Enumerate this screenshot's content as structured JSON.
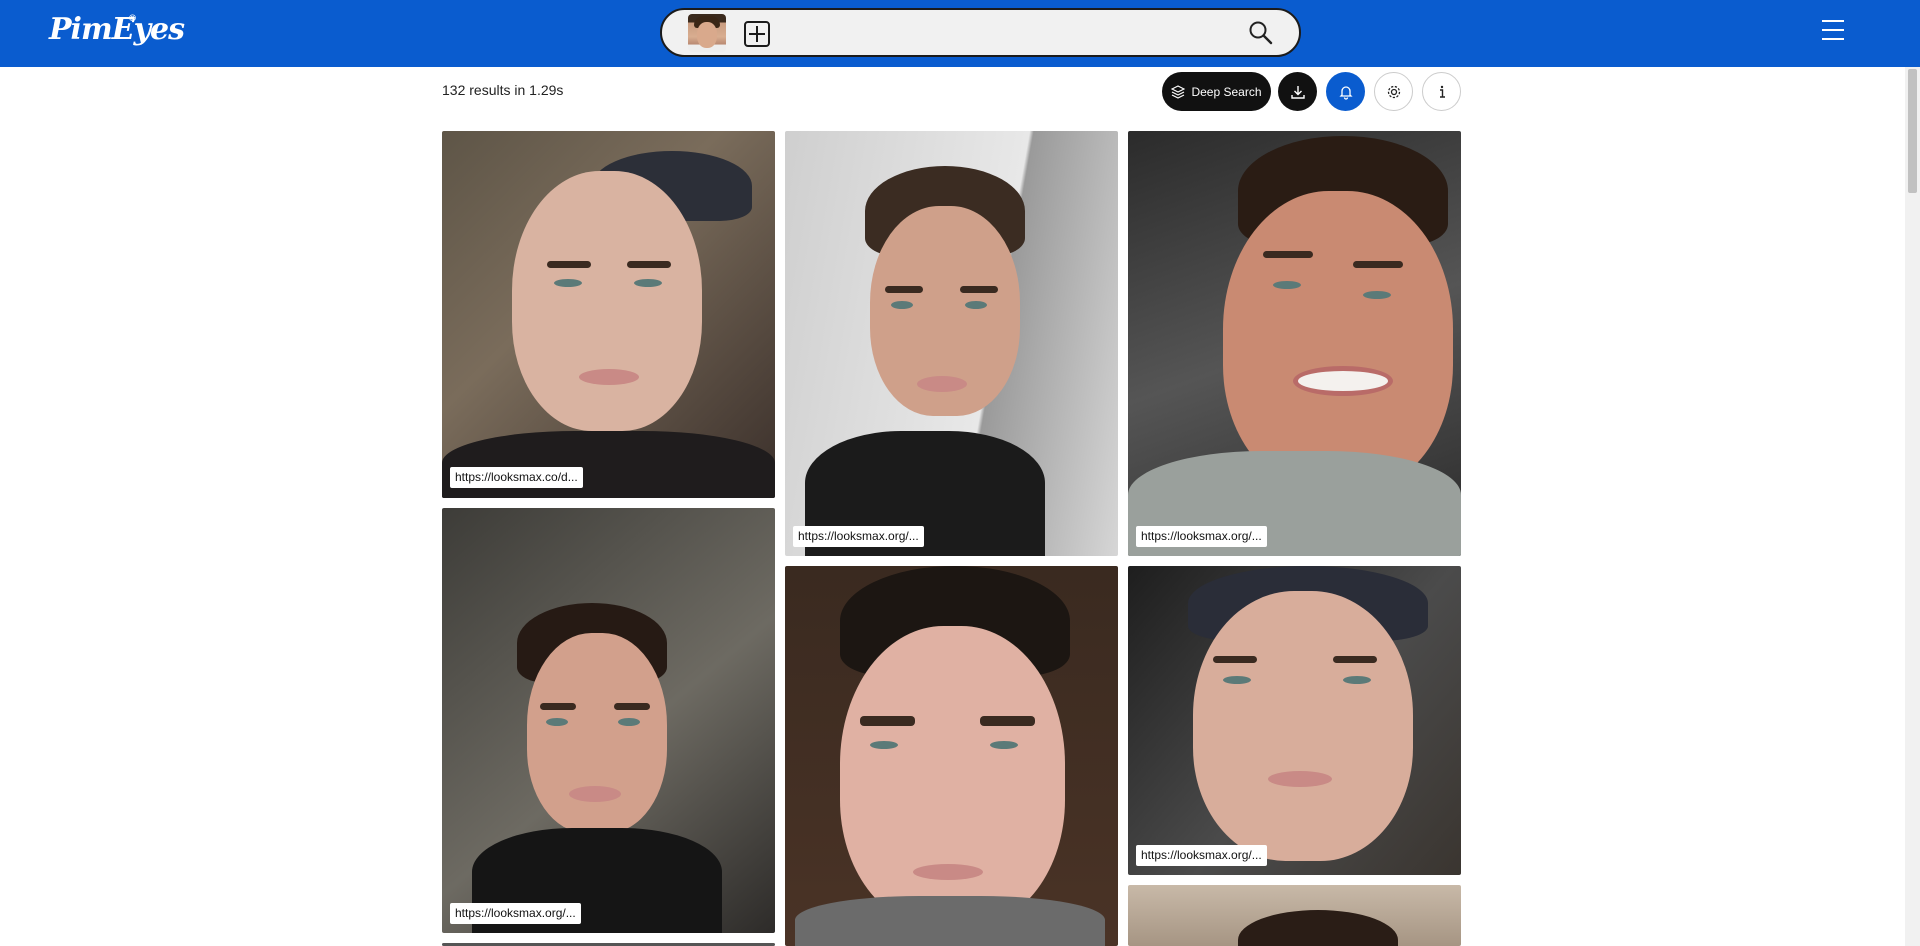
{
  "header": {
    "logo": "PimEyes",
    "logo_mark": "®",
    "search_placeholder": "",
    "add_icon": "plus-square-icon",
    "search_icon": "magnifier-icon",
    "menu_icon": "hamburger-icon",
    "brand_color": "#0a5ccf"
  },
  "toolbar": {
    "results_text": "132 results in 1.29s",
    "deep_search_label": "Deep Search",
    "download_icon": "download-icon",
    "alert_icon": "bell-icon",
    "settings_icon": "gear-icon",
    "info_icon": "info-icon"
  },
  "results": [
    {
      "url": "https://looksmax.co/d..."
    },
    {
      "url": "https://looksmax.org/..."
    },
    {
      "url": "https://looksmax.org/..."
    },
    {
      "url": "https://looksmax.org/..."
    },
    {
      "url": ""
    },
    {
      "url": "https://looksmax.org/..."
    },
    {
      "url": ""
    }
  ]
}
